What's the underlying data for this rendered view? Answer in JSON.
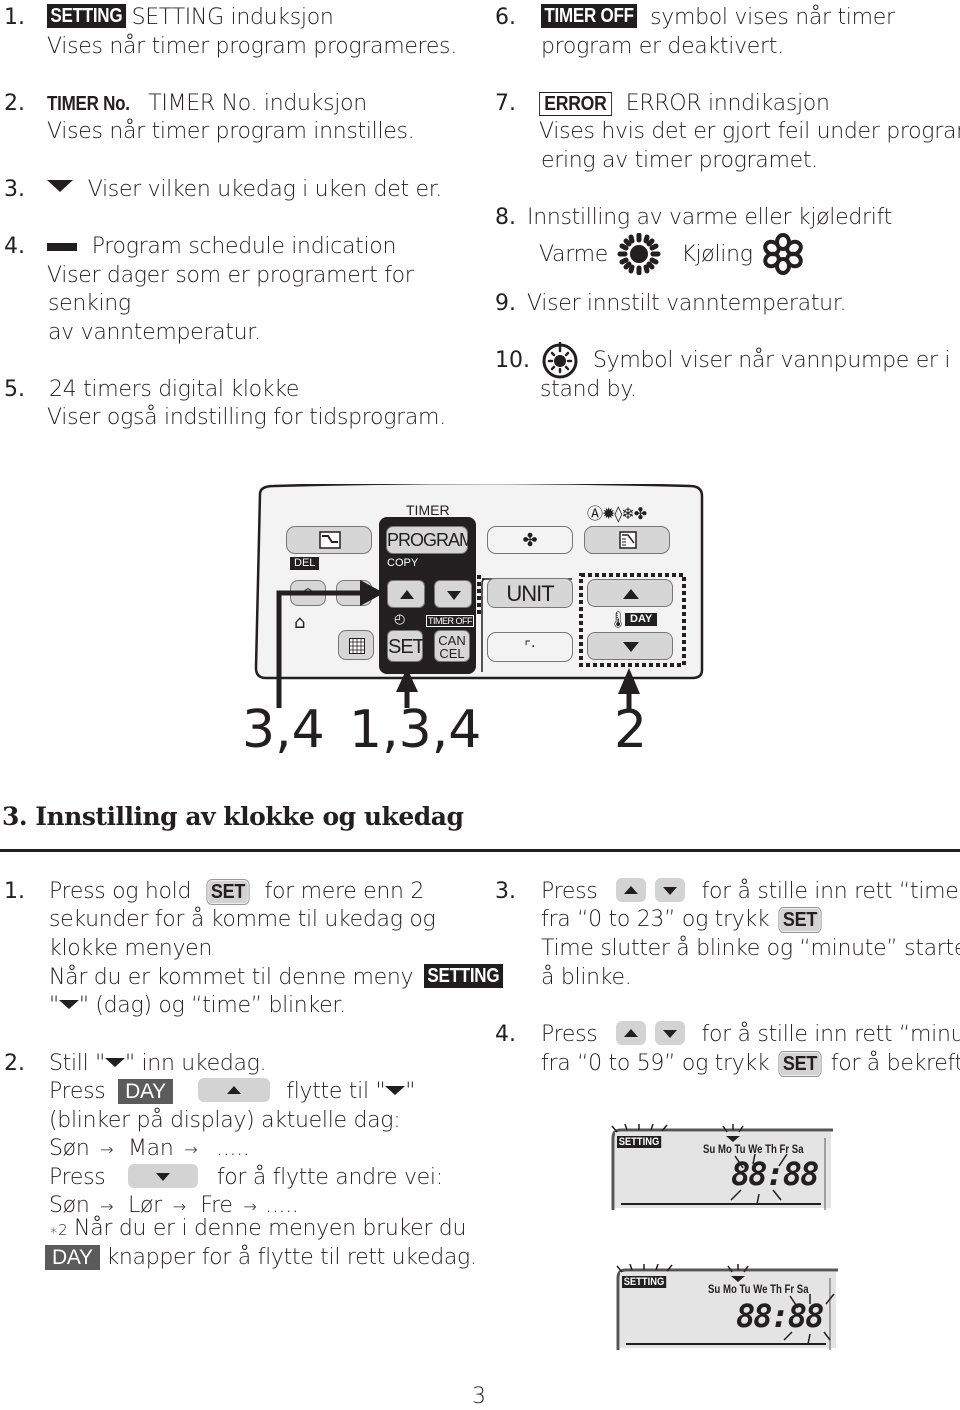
{
  "legend_left": [
    {
      "num": "1.",
      "badge": "SETTING",
      "line1": "SETTING induksjon",
      "line2": "Vises når timer program programeres."
    },
    {
      "num": "2.",
      "badge": "TIMER No.",
      "line1": "TIMER No. induksjon",
      "line2": "Vises når timer program innstilles."
    },
    {
      "num": "3.",
      "icon": "triangle-down-icon",
      "line1": "Viser vilken ukedag i uken det er."
    },
    {
      "num": "4.",
      "icon": "bar-icon",
      "line1": "Program schedule indication",
      "line2": "Viser dager som er programert for",
      "line3": "senking",
      "line4": "av vanntemperatur."
    },
    {
      "num": "5.",
      "line1": "24 timers digital klokke",
      "line2": "Viser også indstilling for tidsprogram."
    }
  ],
  "legend_right": [
    {
      "num": "6.",
      "badge": "TIMER OFF",
      "line1": "symbol vises når timer",
      "line2": "program er deaktivert."
    },
    {
      "num": "7.",
      "badge": "ERROR",
      "line1": "ERROR inndikasjon",
      "line2": "Vises hvis det er gjort feil under program",
      "line3": "ering av timer programet."
    },
    {
      "num": "8.",
      "line1": "Innstilling av varme eller kjøledrift",
      "heat_label": "Varme",
      "cool_label": "Kjøling"
    },
    {
      "num": "9.",
      "line1": "Viser innstilt vanntemperatur."
    },
    {
      "num": "10.",
      "icon": "pump-standby-icon",
      "line1": "Symbol viser når vannpumpe er i",
      "line2": "stand by."
    }
  ],
  "remote": {
    "timer_label": "TIMER",
    "program_button": "PROGRAM",
    "copy_label": "COPY",
    "del_label": "DEL",
    "unit_button": "UNIT",
    "set_button": "SET",
    "cancel_button_line1": "CAN",
    "cancel_button_line2": "CEL",
    "timer_off_label": "TIMER OFF",
    "day_label": "DAY",
    "mode_icons": "Ⓐ✹◊❄✤"
  },
  "callouts": {
    "left": "3,4",
    "middle": "1,3,4",
    "right": "2"
  },
  "section": {
    "heading": "3. Innstilling av klokke og ukedag"
  },
  "steps_left": {
    "step1": {
      "num": "1.",
      "a": "Press og hold",
      "set_key": "SET",
      "b": "for mere enn 2",
      "line2": "sekunder for å komme til ukedag og",
      "line3": "klokke menyen",
      "line4": "Når du er kommet til denne meny",
      "setting_badge": "SETTING",
      "line5_quote_open": "\"",
      "line5_quote_close": "\"",
      "line5_rest": "(dag) og “time”  blinker."
    },
    "step2": {
      "num": "2.",
      "line1a": "Still",
      "line1b": "inn ukedag.",
      "press": "Press",
      "day_key": "DAY",
      "move_to": "flytte til",
      "line3": "(blinker på display) aktuelle dag:",
      "seq1": [
        "Søn",
        "Man",
        "....."
      ],
      "press2": "Press",
      "other_way": "for å flytte andre vei:",
      "seq2": [
        "Søn",
        "Lør",
        "Fre",
        "....."
      ],
      "note_mark": "∗2",
      "note": "Når du er i denne menyen bruker du",
      "note_day_key": "DAY",
      "note2": "knapper for å flytte til rett ukedag."
    }
  },
  "steps_right": {
    "step3": {
      "num": "3.",
      "press": "Press",
      "a": "for å stille inn rett “time”",
      "line2a": "fra “0 to 23” og trykk",
      "set_key": "SET",
      "line3": "Time slutter å blinke og “minute” starter",
      "line4": "å blinke."
    },
    "step4": {
      "num": "4.",
      "press": "Press",
      "a": "for å stille inn rett “minut”",
      "line2a": "fra “0 to 59” og trykk",
      "set_key": "SET",
      "line2b": "for å bekrefte."
    }
  },
  "lcd_displays": [
    {
      "setting": "SETTING",
      "days": [
        "Su",
        "Mo",
        "Tu",
        "We",
        "Th",
        "Fr",
        "Sa"
      ],
      "time": "88:88",
      "blinking": "hour"
    },
    {
      "setting": "SETTING",
      "days": [
        "Su",
        "Mo",
        "Tu",
        "We",
        "Th",
        "Fr",
        "Sa"
      ],
      "time": "88:88",
      "blinking": "minute"
    }
  ],
  "page_number": "3"
}
